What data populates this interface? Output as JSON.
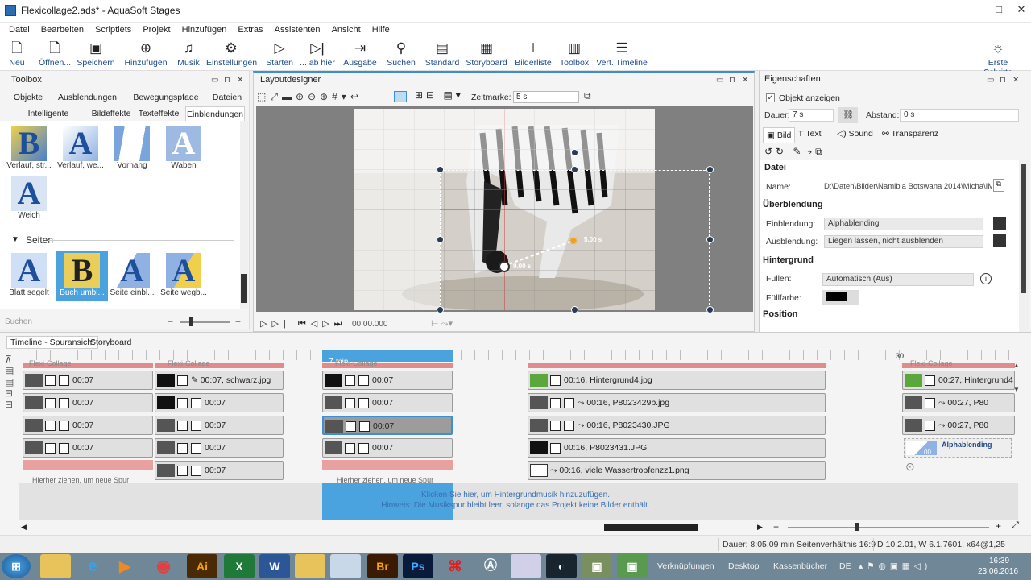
{
  "window": {
    "title": "Flexicollage2.ads* - AquaSoft Stages"
  },
  "menu": [
    "Datei",
    "Bearbeiten",
    "Scriptlets",
    "Projekt",
    "Hinzufügen",
    "Extras",
    "Assistenten",
    "Ansicht",
    "Hilfe"
  ],
  "toolbar": {
    "items": [
      {
        "label": "Neu",
        "icon": "new-document-icon"
      },
      {
        "label": "Öffnen...",
        "icon": "open-icon"
      },
      {
        "label": "Speichern",
        "icon": "save-icon"
      },
      {
        "label": "Hinzufügen",
        "icon": "add-icon"
      },
      {
        "label": "Musik",
        "icon": "music-icon"
      },
      {
        "label": "Einstellungen",
        "icon": "gear-icon"
      },
      {
        "label": "Starten",
        "icon": "play-icon"
      },
      {
        "label": "... ab hier",
        "icon": "play-from-here-icon"
      },
      {
        "label": "Ausgabe",
        "icon": "export-icon"
      },
      {
        "label": "Suchen",
        "icon": "search-icon"
      },
      {
        "label": "Standard",
        "icon": "standard-layout-icon"
      },
      {
        "label": "Storyboard",
        "icon": "storyboard-icon"
      },
      {
        "label": "Bilderliste",
        "icon": "image-list-icon"
      },
      {
        "label": "Toolbox",
        "icon": "toolbox-icon"
      },
      {
        "label": "Vert. Timeline",
        "icon": "vertical-timeline-icon"
      }
    ],
    "first_steps": "Erste Schritte"
  },
  "toolbox": {
    "title": "Toolbox",
    "tabs_row1": [
      "Objekte",
      "Ausblendungen",
      "Bewegungspfade",
      "Dateien"
    ],
    "tabs_row2": [
      "Intelligente Vorlagen",
      "Bildeffekte",
      "Texteffekte",
      "Einblendungen"
    ],
    "transitions": [
      {
        "label": "Verlauf, str...",
        "glyph": "B"
      },
      {
        "label": "Verlauf, we...",
        "glyph": "A"
      },
      {
        "label": "Vorhang",
        "glyph": ""
      },
      {
        "label": "Waben",
        "glyph": "A"
      },
      {
        "label": "Weich",
        "glyph": "A"
      }
    ],
    "section_pages": "Seiten",
    "pages": [
      {
        "label": "Blatt segelt",
        "glyph": "A"
      },
      {
        "label": "Buch umbl...",
        "glyph": "B"
      },
      {
        "label": "Seite einbl...",
        "glyph": "A"
      },
      {
        "label": "Seite wegb...",
        "glyph": "A"
      }
    ],
    "search_placeholder": "Suchen"
  },
  "layoutdesigner": {
    "title": "Layoutdesigner",
    "zeitmarke_label": "Zeitmarke:",
    "zeitmarke_value": "5 s",
    "time_start": "0.00 s",
    "time_end": "5.00 s",
    "playback_time": "00:00.000"
  },
  "properties": {
    "title": "Eigenschaften",
    "show_object": "Objekt anzeigen",
    "duration_label": "Dauer:",
    "duration_value": "7 s",
    "distance_label": "Abstand:",
    "distance_value": "0 s",
    "tabs": [
      "Bild",
      "Text",
      "Sound",
      "Transparenz"
    ],
    "section_file": "Datei",
    "name_label": "Name:",
    "name_value": "D:\\Daten\\Bilder\\Namibia Botswana 2014\\Micha\\IM",
    "section_transition": "Überblendung",
    "fade_in_label": "Einblendung:",
    "fade_in_value": "Alphablending",
    "fade_out_label": "Ausblendung:",
    "fade_out_value": "Liegen lassen, nicht ausblenden",
    "section_background": "Hintergrund",
    "fill_label": "Füllen:",
    "fill_value": "Automatisch (Aus)",
    "fill_color_label": "Füllfarbe:",
    "fill_color": "#000000",
    "section_position": "Position"
  },
  "timeline": {
    "tabs": [
      "Timeline - Spuransicht",
      "Storyboard"
    ],
    "marker_label": "7 min",
    "ruler_label": "30",
    "col1": [
      "00:07",
      "00:07",
      "00:07",
      "00:07"
    ],
    "col2": [
      "00:07, schwarz.jpg",
      "00:07",
      "00:07",
      "00:07"
    ],
    "col3": [
      "00:07",
      "00:07",
      "00:07",
      "00:07"
    ],
    "col4": [
      "00:16, Hintergrund4.jpg",
      "00:16, P8023429b.jpg",
      "00:16, P8023430.JPG",
      "00:16, P8023431.JPG",
      "00:16, viele Wassertropfenzz1.png"
    ],
    "col5": [
      "00:27, Hintergrund4",
      "00:27, P80",
      "00:27, P80"
    ],
    "group_label": "Flexi-Collage",
    "drop_hint": "Hierher ziehen, um neue Spur",
    "alphablending_label": "Alphablending",
    "alphablending_time": "00...",
    "music_hint_1": "Klicken Sie hier, um Hintergrundmusik hinzuzufügen.",
    "music_hint_2": "Hinweis: Die Musikspur bleibt leer, solange das Projekt keine Bilder enthält."
  },
  "status": {
    "duration": "Dauer: 8:05.09 min",
    "aspect": "Seitenverhältnis 16:9",
    "version": "D 10.2.01, W 6.1.7601, x64@1,25"
  },
  "taskbar": {
    "apps": [
      "windows-start-icon",
      "folder-icon",
      "internet-explorer-icon",
      "media-player-icon",
      "chrome-icon",
      "illustrator-icon",
      "excel-icon",
      "word-icon",
      "explorer-icon",
      "notepad-icon",
      "bridge-icon",
      "photoshop-icon",
      "acrobat-icon",
      "aquasoft-icon",
      "paint-icon",
      "stages-icon",
      "recorder-icon",
      "file-icon"
    ],
    "app_texts": {
      "illustrator": "Ai",
      "bridge": "Br",
      "photoshop": "Ps"
    },
    "links": [
      "Verknüpfungen",
      "Desktop",
      "Kassenbücher"
    ],
    "lang": "DE",
    "time": "16:39",
    "date": "23.06.2016"
  },
  "colors": {
    "accent_blue": "#3c8fd6",
    "clip_selected": "#4aa3df",
    "group_bar": "#e28b8b",
    "taskbar": "#6f8796"
  }
}
